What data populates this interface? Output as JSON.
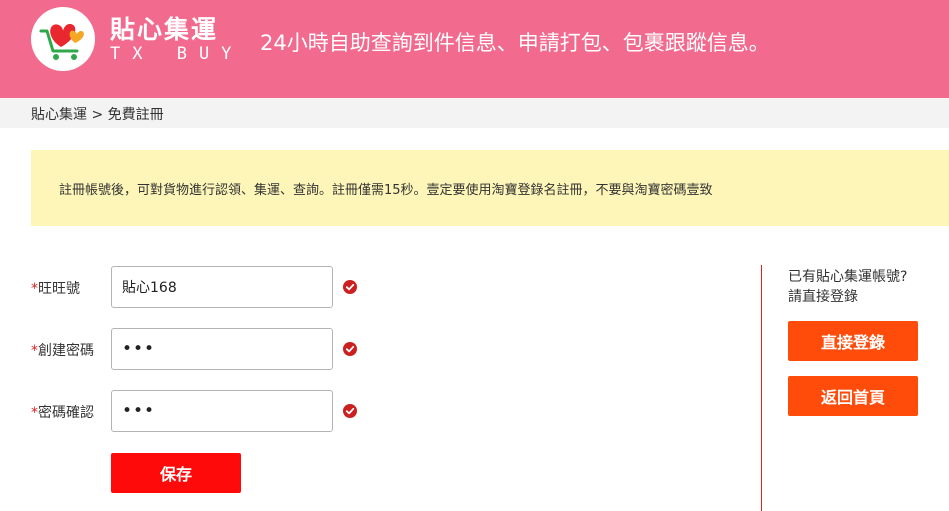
{
  "header": {
    "brand_name": "貼心集運",
    "brand_sub": "TX BUY",
    "slogan": "24小時自助查詢到件信息、申請打包、包裹跟蹤信息。",
    "colors": {
      "header_bg": "#f26b8f",
      "logo_heart": "#f5a623",
      "logo_heart2": "#e8272f",
      "logo_cart": "#2ea84a"
    }
  },
  "breadcrumb": {
    "text": "貼心集運 > 免費註冊"
  },
  "notice": {
    "text": "註冊帳號後，可對貨物進行認領、集運、查詢。註冊僅需15秒。壹定要使用淘寶登錄名註冊，不要與淘寶密碼壹致"
  },
  "form": {
    "required_mark": "*",
    "fields": [
      {
        "label": "旺旺號",
        "value": "貼心168",
        "type": "text",
        "status": "valid"
      },
      {
        "label": "創建密碼",
        "value": "•••",
        "type": "password",
        "status": "valid"
      },
      {
        "label": "密碼確認",
        "value": "•••",
        "type": "password",
        "status": "valid"
      }
    ],
    "save_label": "保存"
  },
  "sidebar": {
    "question_line1": "已有貼心集運帳號?",
    "question_line2": "請直接登錄",
    "login_label": "直接登錄",
    "home_label": "返回首頁"
  },
  "colors": {
    "accent_red": "#ff0a0a",
    "accent_orange": "#ff4c0a",
    "notice_bg": "#fdf6b8",
    "valid_icon": "#cc1f1f"
  }
}
